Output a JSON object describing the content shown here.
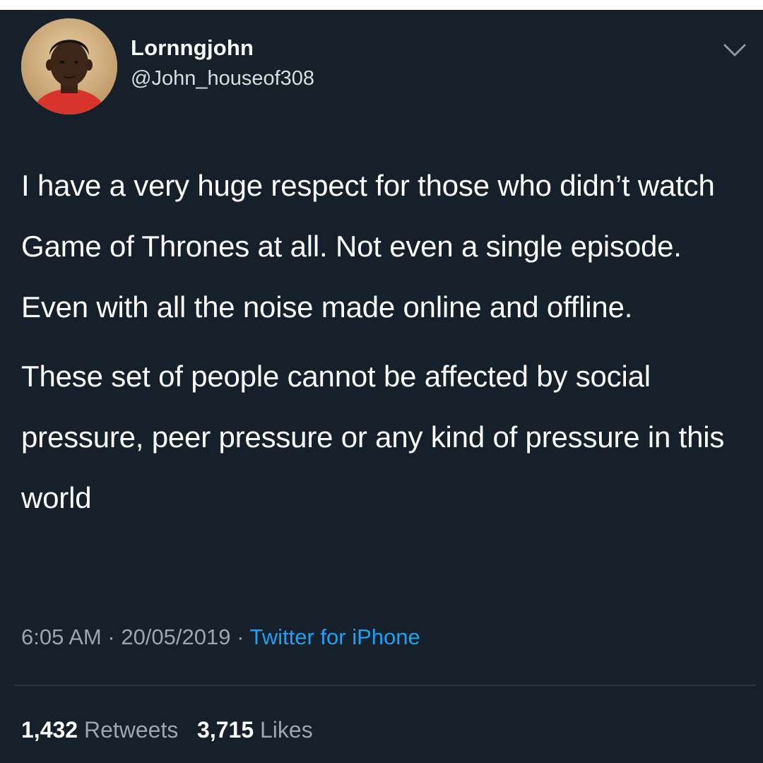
{
  "user": {
    "display_name": "Lornngjohn",
    "handle": "@John_houseof308"
  },
  "tweet": {
    "paragraphs": [
      "I have a very huge respect for those who didn’t watch Game of Thrones at all. Not even a single episode. Even with all the noise made online and offline.",
      "These set of people cannot be affected by social pressure, peer pressure or any kind of pressure in this world"
    ]
  },
  "meta": {
    "time": "6:05 AM",
    "separator": "·",
    "date": "20/05/2019",
    "source": "Twitter for iPhone"
  },
  "stats": {
    "retweets_count": "1,432",
    "retweets_label": "Retweets",
    "likes_count": "3,715",
    "likes_label": "Likes"
  },
  "icons": {
    "menu": "chevron-down-icon",
    "avatar": "profile-photo"
  },
  "colors": {
    "background": "#15202b",
    "text": "#ffffff",
    "secondary_text": "#9aa5b0",
    "link": "#1da1f2"
  }
}
